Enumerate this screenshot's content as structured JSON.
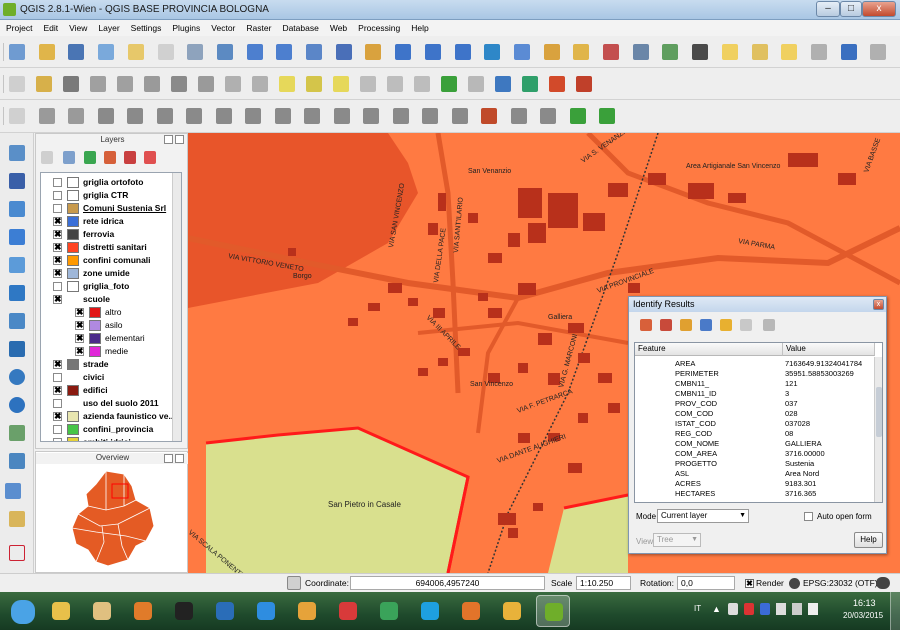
{
  "window": {
    "title": "QGIS 2.8.1-Wien - QGIS BASE PROVINCIA BOLOGNA",
    "min_label": "–",
    "max_label": "□",
    "close_label": "x"
  },
  "menu": [
    "Project",
    "Edit",
    "View",
    "Layer",
    "Settings",
    "Plugins",
    "Vector",
    "Raster",
    "Database",
    "Web",
    "Processing",
    "Help"
  ],
  "toolbar_icons": {
    "row1": [
      "new-project-icon",
      "open-project-icon",
      "save-project-icon",
      "save-as-icon",
      "new-print-composer-icon",
      "composer-manager-icon",
      "pan-icon",
      "pan-to-selection-icon",
      "zoom-in-icon",
      "zoom-out-icon",
      "zoom-native-icon",
      "zoom-full-icon",
      "zoom-to-selection-icon",
      "zoom-to-layer-icon",
      "zoom-last-icon",
      "zoom-next-icon",
      "refresh-icon",
      "identify-icon",
      "select-icon",
      "deselect-icon",
      "field-calculator-icon",
      "attribute-table-icon",
      "statistics-icon",
      "measure-icon",
      "map-tips-icon",
      "new-bookmark-icon",
      "bookmarks-icon",
      "text-annotation-icon",
      "help-icon",
      "whats-this-icon"
    ],
    "row2": [
      "current-edits-icon",
      "toggle-editing-icon",
      "save-edits-icon",
      "add-feature-icon",
      "move-feature-icon",
      "node-tool-icon",
      "delete-selected-icon",
      "cut-features-icon",
      "copy-features-icon",
      "paste-features-icon",
      "label-icon",
      "pin-labels-icon",
      "show-hide-labels-icon",
      "move-label-icon",
      "rotate-label-icon",
      "change-label-icon",
      "gps-icon",
      "csv-icon",
      "python-icon",
      "plugin-icon",
      "settings-plugin-icon",
      "paint-icon"
    ],
    "row3": [
      "advanced-edit-icon",
      "undo-icon",
      "redo-icon",
      "simplify-icon",
      "add-ring-icon",
      "add-part-icon",
      "fill-ring-icon",
      "delete-ring-icon",
      "delete-part-icon",
      "reshape-icon",
      "offset-curve-icon",
      "split-features-icon",
      "split-parts-icon",
      "merge-selected-icon",
      "merge-attributes-icon",
      "rotate-point-icon",
      "rotate-feature-icon",
      "digitize-icon",
      "shape-digitize-icon",
      "table-icon",
      "layer-table-icon"
    ]
  },
  "layers_panel": {
    "title": "Layers",
    "items": [
      {
        "label": "griglia ortofoto",
        "checked": false,
        "bold": true,
        "swatch": "#ffffff"
      },
      {
        "label": "griglia CTR",
        "checked": false,
        "bold": true,
        "swatch": "#ffffff"
      },
      {
        "label": "Comuni Sustenia Srl",
        "checked": false,
        "bold": true,
        "swatch": "#c89a4d",
        "underline": true
      },
      {
        "label": "rete idrica",
        "checked": true,
        "bold": true,
        "swatch": "#3a6fd8"
      },
      {
        "label": "ferrovia",
        "checked": true,
        "bold": true,
        "swatch": "#444444"
      },
      {
        "label": "distretti sanitari",
        "checked": true,
        "bold": true,
        "swatch": "#ff4422"
      },
      {
        "label": "confini comunali",
        "checked": true,
        "bold": true,
        "swatch": "#ff9900"
      },
      {
        "label": "zone umide",
        "checked": true,
        "bold": true,
        "swatch": "#9fb7d9"
      },
      {
        "label": "griglia_foto",
        "checked": false,
        "bold": true,
        "swatch": "#ffffff"
      },
      {
        "label": "scuole",
        "checked": true,
        "bold": true,
        "swatch": ""
      },
      {
        "label": "altro",
        "checked": true,
        "bold": false,
        "swatch": "#e21616",
        "indent": true
      },
      {
        "label": "asilo",
        "checked": true,
        "bold": false,
        "swatch": "#b089e0",
        "indent": true
      },
      {
        "label": "elementari",
        "checked": true,
        "bold": false,
        "swatch": "#4b2a8a",
        "indent": true
      },
      {
        "label": "medie",
        "checked": true,
        "bold": false,
        "swatch": "#e026d8",
        "indent": true
      },
      {
        "label": "strade",
        "checked": true,
        "bold": true,
        "swatch": "#777777"
      },
      {
        "label": "civici",
        "checked": false,
        "bold": true,
        "swatch": ""
      },
      {
        "label": "edifici",
        "checked": true,
        "bold": true,
        "swatch": "#8a1a10"
      },
      {
        "label": "uso del suolo 2011",
        "checked": false,
        "bold": true,
        "swatch": ""
      },
      {
        "label": "azienda faunistico ve...",
        "checked": true,
        "bold": true,
        "swatch": "#e8e6b0"
      },
      {
        "label": "confini_provincia",
        "checked": false,
        "bold": true,
        "swatch": "#47c447"
      },
      {
        "label": "ambiti idrici",
        "checked": false,
        "bold": true,
        "swatch": "#e6d23a"
      }
    ]
  },
  "overview_panel": {
    "title": "Overview"
  },
  "map": {
    "labels": {
      "via_vittorio_veneto": "VIA VITTORIO VENETO",
      "borgo": "Borgo",
      "via_san_vincenzo": "VIA SAN VINCENZO",
      "via_della_pace": "VIA DELLA PACE",
      "via_sant_ilario": "VIA SANT'ILARIO",
      "san_venanzio": "San Venanzio",
      "via_s_venanzio": "VIA S. VENANZIO",
      "area_artigianale": "Area Artigianale San Vincenzo",
      "via_basse": "VIA BASSE",
      "via_parma": "VIA PARMA",
      "via_provinciale": "VIA PROVINCIALE",
      "galliera": "Galliera",
      "san_vincenzo": "San Vincenzo",
      "via_petrarca": "VIA F. PETRARCA",
      "via_dante": "VIA DANTE ALIGHIERI",
      "via_marconi": "VIA G. MARCONI",
      "via_iii_aprile": "VIA III APRILE",
      "san_pietro": "San Pietro in Casale",
      "scala_ponente": "VIA SCALA PONENTE"
    }
  },
  "identify": {
    "title": "Identify Results",
    "close_label": "x",
    "header_feature": "Feature",
    "header_value": "Value",
    "rows": [
      {
        "key": "AREA",
        "value": "7163649.91324041784"
      },
      {
        "key": "PERIMETER",
        "value": "35951.58853003269"
      },
      {
        "key": "CMBN11_",
        "value": "121"
      },
      {
        "key": "CMBN11_ID",
        "value": "3"
      },
      {
        "key": "PROV_COD",
        "value": "037"
      },
      {
        "key": "COM_COD",
        "value": "028"
      },
      {
        "key": "ISTAT_COD",
        "value": "037028"
      },
      {
        "key": "REG_COD",
        "value": "08"
      },
      {
        "key": "COM_NOME",
        "value": "GALLIERA"
      },
      {
        "key": "COM_AREA",
        "value": "3716.00000"
      },
      {
        "key": "PROGETTO",
        "value": "Sustenia"
      },
      {
        "key": "ASL",
        "value": "Area Nord"
      },
      {
        "key": "ACRES",
        "value": "9183.301"
      },
      {
        "key": "HECTARES",
        "value": "3716.365"
      }
    ],
    "mode_label": "Mode",
    "mode_value": "Current layer",
    "auto_open_label": "Auto open form",
    "view_label": "View",
    "view_value": "Tree",
    "help_label": "Help"
  },
  "status": {
    "coordinate_label": "Coordinate:",
    "coordinate_value": "694006,4957240",
    "scale_label": "Scale",
    "scale_value": "1:10.250",
    "rotation_label": "Rotation:",
    "rotation_value": "0,0",
    "render_label": "Render",
    "crs_label": "EPSG:23032 (OTF)"
  },
  "taskbar": {
    "language": "IT",
    "time": "16:13",
    "date": "20/03/2015",
    "apps": [
      "windows-start-icon",
      "folder-explorer-icon",
      "file-manager-icon",
      "media-player-icon",
      "hp-icon",
      "stock-chart-icon",
      "internet-explorer-icon",
      "flash-icon",
      "opera-icon",
      "vector-editor-icon",
      "skype-icon",
      "firefox-icon",
      "chrome-icon",
      "qgis-icon"
    ]
  },
  "colors": {
    "map_bg": "#ff7a42",
    "map_dark": "#e8552a",
    "building": "#b8301b",
    "field": "#d9e08e",
    "boundary": "#ff1a1a"
  }
}
